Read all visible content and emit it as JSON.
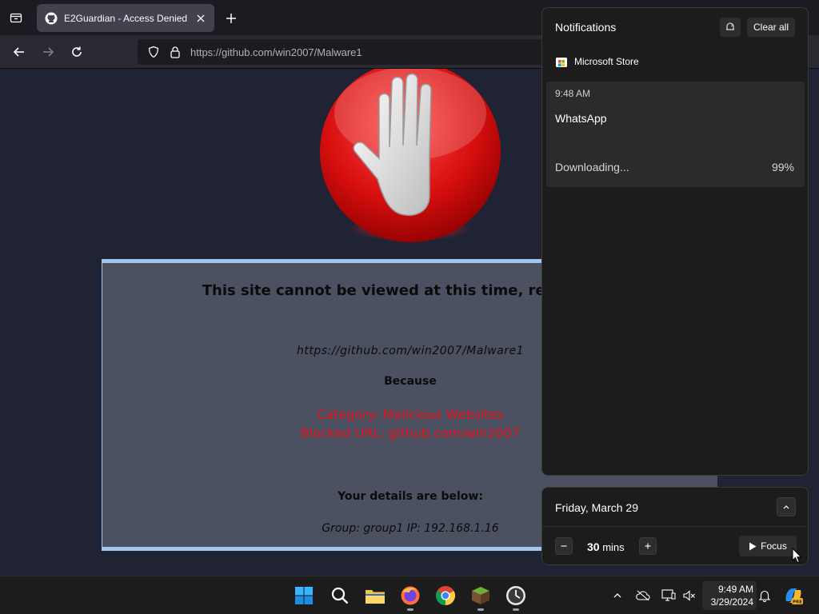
{
  "browser": {
    "tab_title": "E2Guardian - Access Denied",
    "url_host": "https://github.com",
    "url_path": "/win2007/Malware1"
  },
  "page": {
    "headline": "This site cannot be viewed at this time, read below",
    "blocked_url": "https://github.com/win2007/Malware1",
    "because": "Because",
    "category": "Category: Malicious Websites",
    "blocked_entry": "Blocked URL: github.com/win2007",
    "details_label": "Your details are below:",
    "details": "Group: group1   IP: 192.168.1.16",
    "colors": {
      "reason_red": "#e8131b",
      "panel_border": "#a4c6ee"
    }
  },
  "notifications": {
    "title": "Notifications",
    "clear_all": "Clear all",
    "app_name": "Microsoft Store",
    "item": {
      "time": "9:48 AM",
      "app": "WhatsApp",
      "status": "Downloading...",
      "progress": "99%"
    }
  },
  "calendar": {
    "date": "Friday, March 29",
    "duration_value": "30",
    "duration_unit": "mins",
    "focus_label": "Focus"
  },
  "taskbar": {
    "apps": [
      "start-icon",
      "search-icon",
      "file-explorer-icon",
      "firefox-icon",
      "chrome-icon",
      "minecraft-icon",
      "clock-app-icon"
    ],
    "time": "9:49 AM",
    "date": "3/29/2024",
    "copilot_badge": "PRE"
  }
}
